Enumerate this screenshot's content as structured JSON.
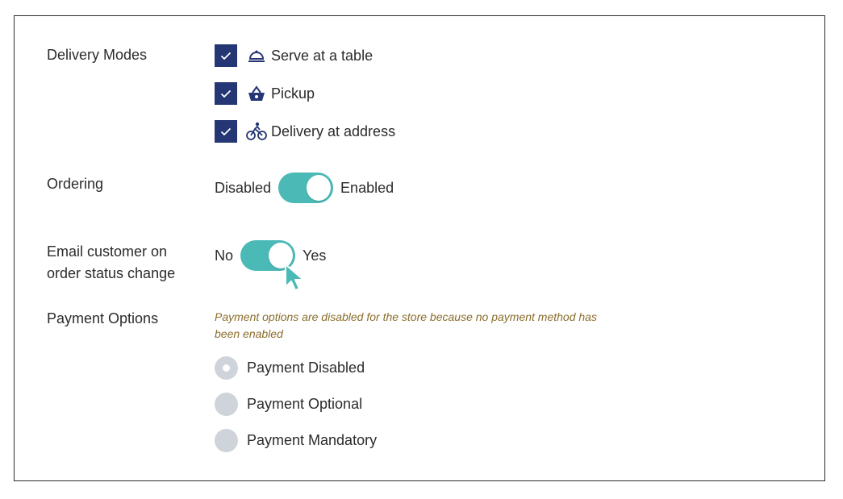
{
  "delivery": {
    "label": "Delivery Modes",
    "modes": [
      {
        "label": "Serve at a table",
        "checked": true,
        "icon": "cloche-icon"
      },
      {
        "label": "Pickup",
        "checked": true,
        "icon": "basket-icon"
      },
      {
        "label": "Delivery at address",
        "checked": true,
        "icon": "bicycle-icon"
      }
    ]
  },
  "ordering": {
    "label": "Ordering",
    "off_label": "Disabled",
    "on_label": "Enabled",
    "state": "on"
  },
  "email_notify": {
    "label_line1": "Email customer on",
    "label_line2": "order status change",
    "off_label": "No",
    "on_label": "Yes",
    "state": "on"
  },
  "payment": {
    "label": "Payment Options",
    "note": "Payment options are disabled for the store because no payment method has been enabled",
    "options": [
      {
        "label": "Payment Disabled",
        "selected": true
      },
      {
        "label": "Payment Optional",
        "selected": false
      },
      {
        "label": "Payment Mandatory",
        "selected": false
      }
    ]
  },
  "colors": {
    "accent": "#4bbab6",
    "checkbox": "#243673",
    "note": "#8a6d2b",
    "radio": "#cfd3da"
  }
}
